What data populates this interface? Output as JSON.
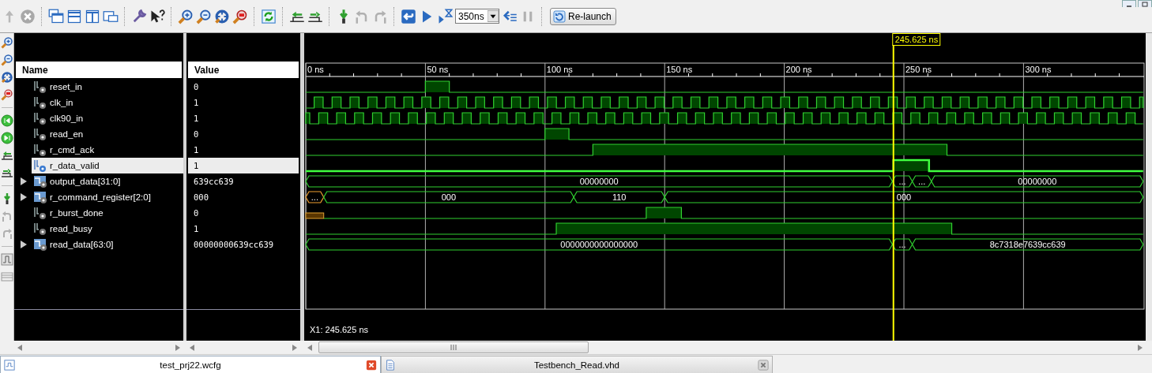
{
  "toolbar": {
    "time_field": {
      "value": "350ns"
    },
    "relaunch_button": {
      "label": "Re-launch"
    }
  },
  "columns": {
    "name": "Name",
    "value": "Value"
  },
  "timeline": {
    "ticks": [
      {
        "label": "0 ns"
      },
      {
        "label": "50 ns"
      },
      {
        "label": "100 ns"
      },
      {
        "label": "150 ns"
      },
      {
        "label": "200 ns"
      },
      {
        "label": "250 ns"
      },
      {
        "label": "300 ns"
      }
    ],
    "cursor_label": "245.625 ns"
  },
  "signals": [
    {
      "name": "reset_in",
      "value": "0",
      "kind": "bit",
      "selected": false
    },
    {
      "name": "clk_in",
      "value": "1",
      "kind": "clock",
      "selected": false
    },
    {
      "name": "clk90_in",
      "value": "1",
      "kind": "clock",
      "selected": false
    },
    {
      "name": "read_en",
      "value": "0",
      "kind": "bit",
      "selected": false
    },
    {
      "name": "r_cmd_ack",
      "value": "1",
      "kind": "bit",
      "selected": false
    },
    {
      "name": "r_data_valid",
      "value": "1",
      "kind": "bit",
      "selected": true
    },
    {
      "name": "output_data[31:0]",
      "value": "639cc639",
      "kind": "bus",
      "selected": false,
      "expanded": false,
      "segments": [
        {
          "label": "00000000",
          "unknown": false
        },
        {
          "label": "...",
          "unknown": false
        },
        {
          "label": "...",
          "unknown": false
        },
        {
          "label": "00000000",
          "unknown": false
        }
      ]
    },
    {
      "name": "r_command_register[2:0]",
      "value": "000",
      "kind": "bus",
      "selected": false,
      "expanded": false,
      "segments": [
        {
          "label": "...",
          "unknown": true
        },
        {
          "label": "000",
          "unknown": false
        },
        {
          "label": "110",
          "unknown": false
        },
        {
          "label": "000",
          "unknown": false
        }
      ]
    },
    {
      "name": "r_burst_done",
      "value": "0",
      "kind": "bit",
      "selected": false
    },
    {
      "name": "read_busy",
      "value": "1",
      "kind": "bit",
      "selected": false
    },
    {
      "name": "read_data[63:0]",
      "value": "00000000639cc639",
      "kind": "bus",
      "selected": false,
      "expanded": false,
      "segments": [
        {
          "label": "0000000000000000",
          "unknown": false
        },
        {
          "label": "...",
          "unknown": false
        },
        {
          "label": "8c7318e7639cc639",
          "unknown": false
        }
      ]
    }
  ],
  "cursor_readout": "X1: 245.625 ns",
  "tabs": [
    {
      "label": "test_prj22.wcfg",
      "selected": true
    },
    {
      "label": "Testbench_Read.vhd",
      "selected": false
    }
  ]
}
